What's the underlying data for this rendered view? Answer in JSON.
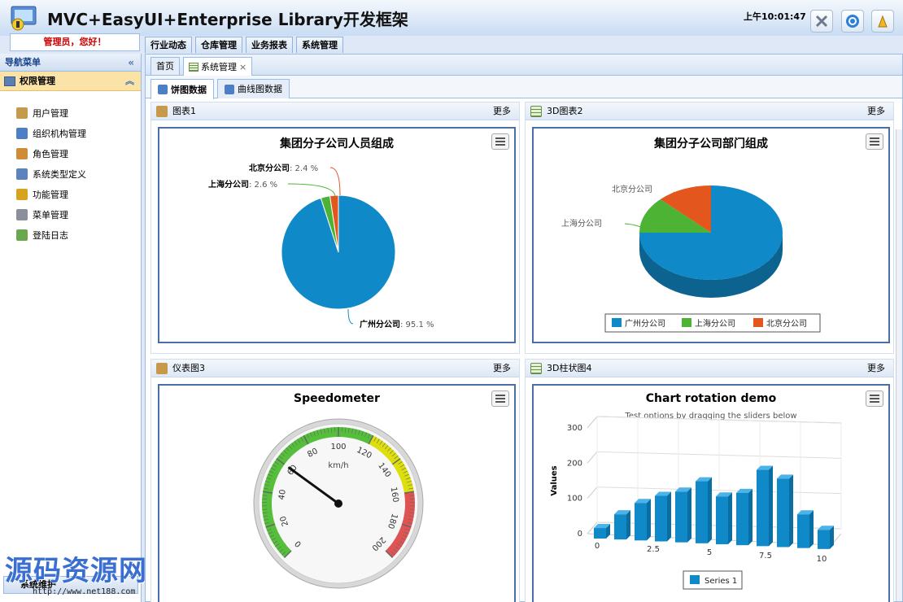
{
  "app": {
    "title": "MVC+EasyUI+Enterprise Library开发框架",
    "clock": "上午10:01:47",
    "greeting": "管理员，您好！"
  },
  "header_buttons": [
    "tools-icon",
    "help-icon",
    "logout-icon"
  ],
  "module_tabs": [
    "行业动态",
    "仓库管理",
    "业务报表",
    "系统管理"
  ],
  "nav": {
    "title": "导航菜单",
    "collapse": "«",
    "group": "权限管理",
    "group_toggle": "︽",
    "items": [
      {
        "label": "用户管理",
        "icon": "user-icon",
        "color": "#c79a4b"
      },
      {
        "label": "组织机构管理",
        "icon": "org-icon",
        "color": "#4d7fc4"
      },
      {
        "label": "角色管理",
        "icon": "role-icon",
        "color": "#d08b38"
      },
      {
        "label": "系统类型定义",
        "icon": "type-icon",
        "color": "#5b84be"
      },
      {
        "label": "功能管理",
        "icon": "key-icon",
        "color": "#d6a21f"
      },
      {
        "label": "菜单管理",
        "icon": "menu-icon",
        "color": "#8a8f99"
      },
      {
        "label": "登陆日志",
        "icon": "log-icon",
        "color": "#6aa84f"
      }
    ],
    "footer": "系统维护"
  },
  "watermark": {
    "text": "源码资源网",
    "url": "http://www.net188.com"
  },
  "content_tabs": [
    {
      "label": "首页",
      "closable": false
    },
    {
      "label": "系统管理",
      "closable": true
    }
  ],
  "close_glyph": "×",
  "sub_tabs": [
    "饼图数据",
    "曲线图数据"
  ],
  "more_label": "更多",
  "panels": [
    {
      "title": "图表1",
      "icon": "user-icon"
    },
    {
      "title": "3D图表2",
      "icon": "grid-icon"
    },
    {
      "title": "仪表图3",
      "icon": "user-icon"
    },
    {
      "title": "3D柱状图4",
      "icon": "grid-icon"
    }
  ],
  "chart_data": [
    {
      "type": "pie",
      "title": "集团分子公司人员组成",
      "slices": [
        {
          "name": "广州分公司",
          "value": 95.1,
          "color": "#1089c8"
        },
        {
          "name": "上海分公司",
          "value": 2.6,
          "color": "#4cb335"
        },
        {
          "name": "北京分公司",
          "value": 2.4,
          "color": "#e3571f"
        }
      ],
      "value_suffix": " %",
      "label_sep": ": "
    },
    {
      "type": "pie",
      "title": "集团分子公司部门组成",
      "three_d": true,
      "slices": [
        {
          "name": "广州分公司",
          "value": 75,
          "color": "#1089c8"
        },
        {
          "name": "上海分公司",
          "value": 12.5,
          "color": "#4cb335"
        },
        {
          "name": "北京分公司",
          "value": 12.5,
          "color": "#e3571f"
        }
      ],
      "legend": "bottom"
    },
    {
      "type": "gauge",
      "title": "Speedometer",
      "unit": "km/h",
      "min": 0,
      "max": 200,
      "value": 60,
      "ticks": [
        0,
        20,
        40,
        60,
        80,
        100,
        120,
        140,
        160,
        180,
        200
      ],
      "bands": [
        {
          "from": 0,
          "to": 120,
          "color": "#55bf3b"
        },
        {
          "from": 120,
          "to": 160,
          "color": "#dddf0d"
        },
        {
          "from": 160,
          "to": 200,
          "color": "#df5353"
        }
      ]
    },
    {
      "type": "bar",
      "three_d": true,
      "title": "Chart rotation demo",
      "subtitle": "Test options by dragging the sliders below",
      "ylabel": "Values",
      "ylim": [
        0,
        300
      ],
      "yticks": [
        0,
        100,
        200,
        300
      ],
      "xticks": [
        "0",
        "2.5",
        "5",
        "7.5",
        "10"
      ],
      "series": [
        {
          "name": "Series 1",
          "values": [
            29.9,
            71.5,
            106.4,
            129.2,
            144.0,
            176.0,
            135.6,
            148.5,
            216.4,
            194.1,
            95.6,
            54.4
          ]
        }
      ],
      "color": "#1089c8"
    }
  ]
}
